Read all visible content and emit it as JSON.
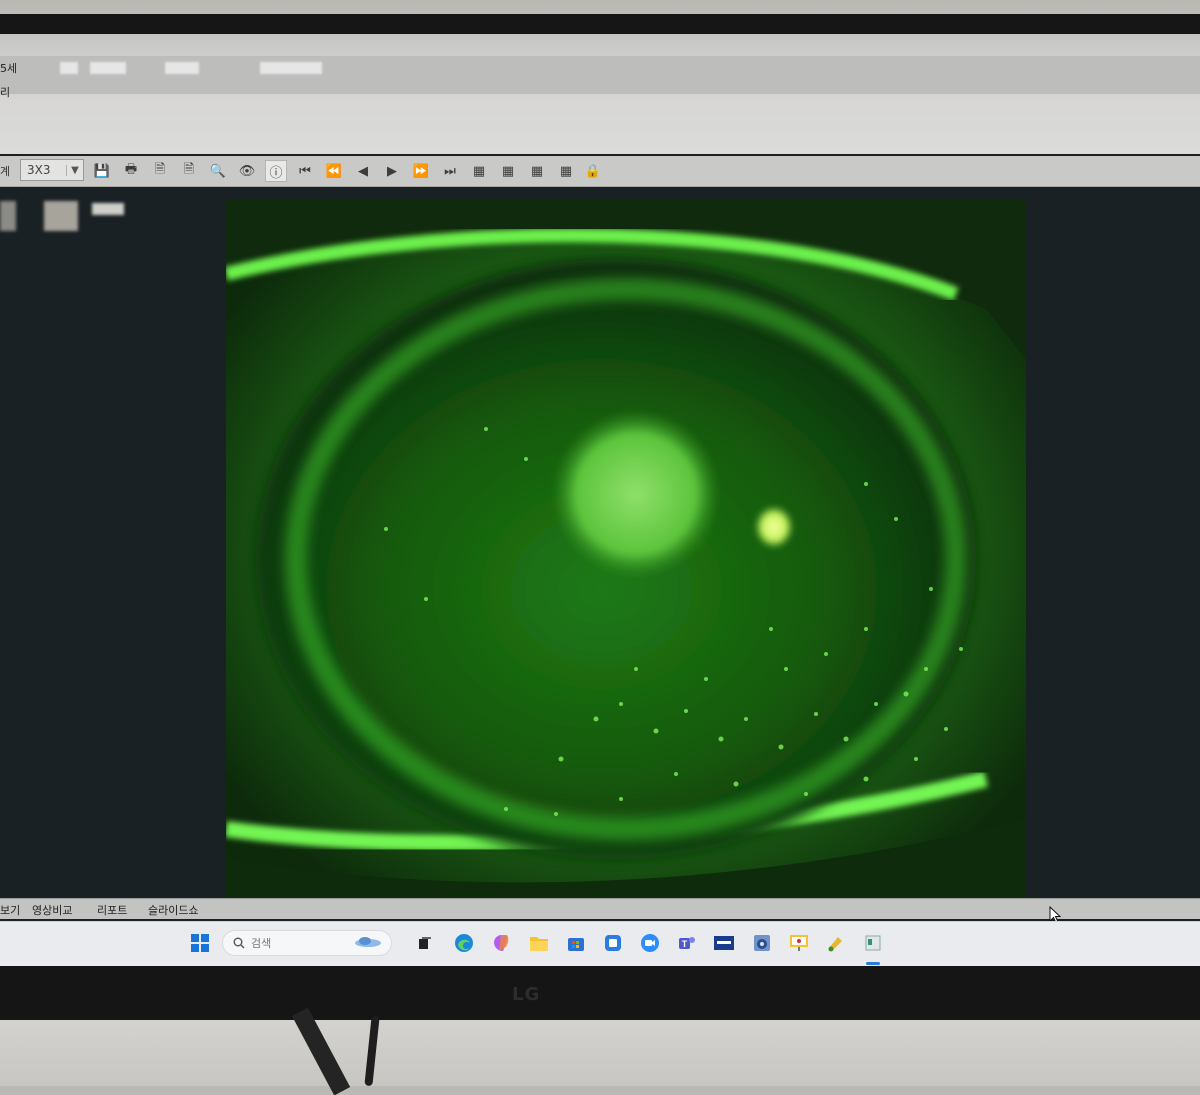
{
  "header": {
    "row1_label": "5세",
    "row2_label": "리"
  },
  "toolbar": {
    "left_label": "계",
    "layout_value": "3X3",
    "buttons": [
      {
        "name": "save-icon",
        "symbol": "💾"
      },
      {
        "name": "print-icon",
        "symbol": "🖶"
      },
      {
        "name": "document-icon",
        "symbol": "🗎"
      },
      {
        "name": "pdf-icon",
        "symbol": "🗎"
      },
      {
        "name": "zoom-icon",
        "symbol": "🔍"
      },
      {
        "name": "eye-icon",
        "symbol": "👁"
      },
      {
        "name": "info-icon",
        "symbol": "ⓘ"
      },
      {
        "name": "first-icon",
        "symbol": "⏮"
      },
      {
        "name": "rewind-icon",
        "symbol": "⏪"
      },
      {
        "name": "previous-icon",
        "symbol": "◀"
      },
      {
        "name": "play-icon",
        "symbol": "▶"
      },
      {
        "name": "fast-forward-icon",
        "symbol": "⏩"
      },
      {
        "name": "last-icon",
        "symbol": "⏭"
      },
      {
        "name": "grid-1-icon",
        "symbol": "▦"
      },
      {
        "name": "grid-2-icon",
        "symbol": "▦"
      },
      {
        "name": "grid-3-icon",
        "symbol": "▦"
      },
      {
        "name": "grid-4-icon",
        "symbol": "▦"
      },
      {
        "name": "lock-icon",
        "symbol": "🔒"
      }
    ]
  },
  "viewer": {
    "image_description_icon": "fluorescein-eye-image",
    "accent_color": "#4dde3a"
  },
  "bottom_tabs": {
    "tab0": "보기",
    "tab1": "영상비교",
    "tab2": "리포트",
    "tab3": "슬라이드쇼"
  },
  "taskbar": {
    "search_placeholder": "검색",
    "apps": [
      "windows-start-icon",
      "search-icon",
      "widgets-icon",
      "task-view-icon",
      "edge-icon",
      "copilot-icon",
      "file-explorer-icon",
      "store-icon",
      "app-icon",
      "zoom-icon",
      "teams-icon",
      "zeiss-icon",
      "viewer-app-icon",
      "presentation-icon",
      "paint-icon",
      "active-app-icon"
    ]
  },
  "monitor": {
    "brand": "LG"
  }
}
